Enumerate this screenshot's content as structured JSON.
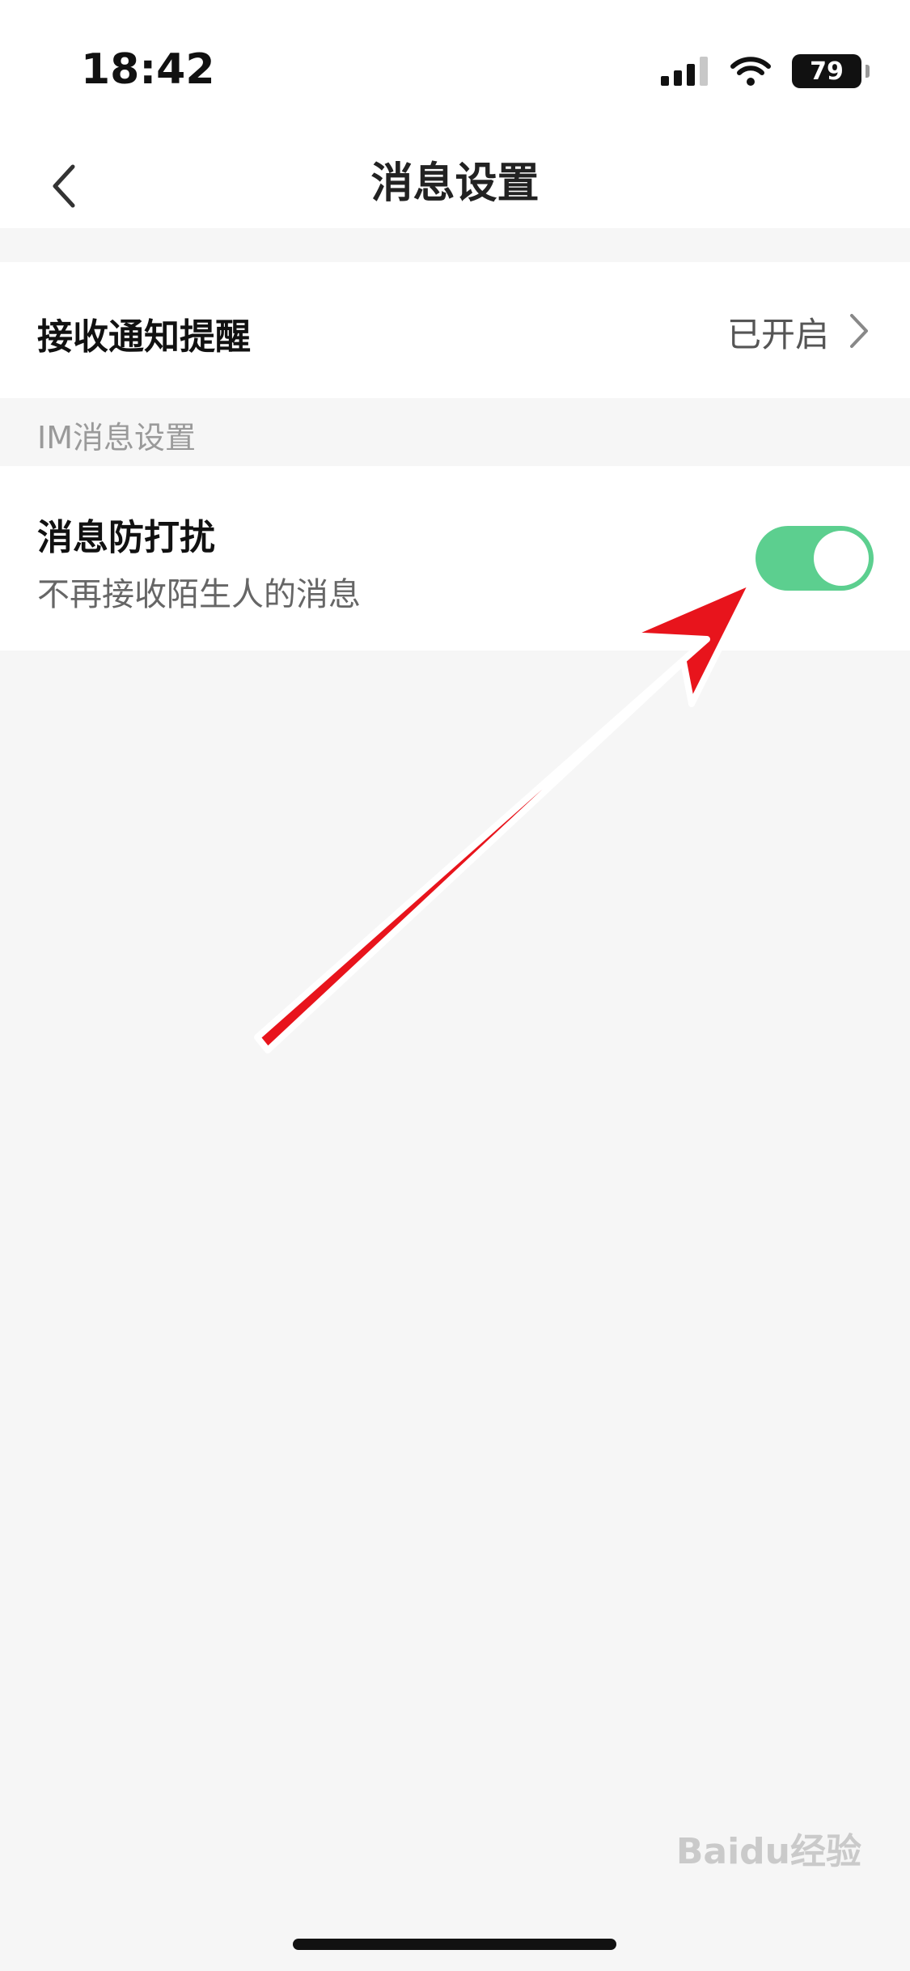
{
  "status_bar": {
    "time": "18:42",
    "battery": "79"
  },
  "nav": {
    "title": "消息设置"
  },
  "notify_row": {
    "label": "接收通知提醒",
    "value": "已开启"
  },
  "im_section": {
    "header": "IM消息设置"
  },
  "dnd_row": {
    "label": "消息防打扰",
    "description": "不再接收陌生人的消息",
    "toggle_on": true,
    "toggle_color": "#5ccf8f"
  },
  "annotation": {
    "arrow_color": "#e8141c"
  },
  "watermark": {
    "text": "Baidu经验"
  }
}
